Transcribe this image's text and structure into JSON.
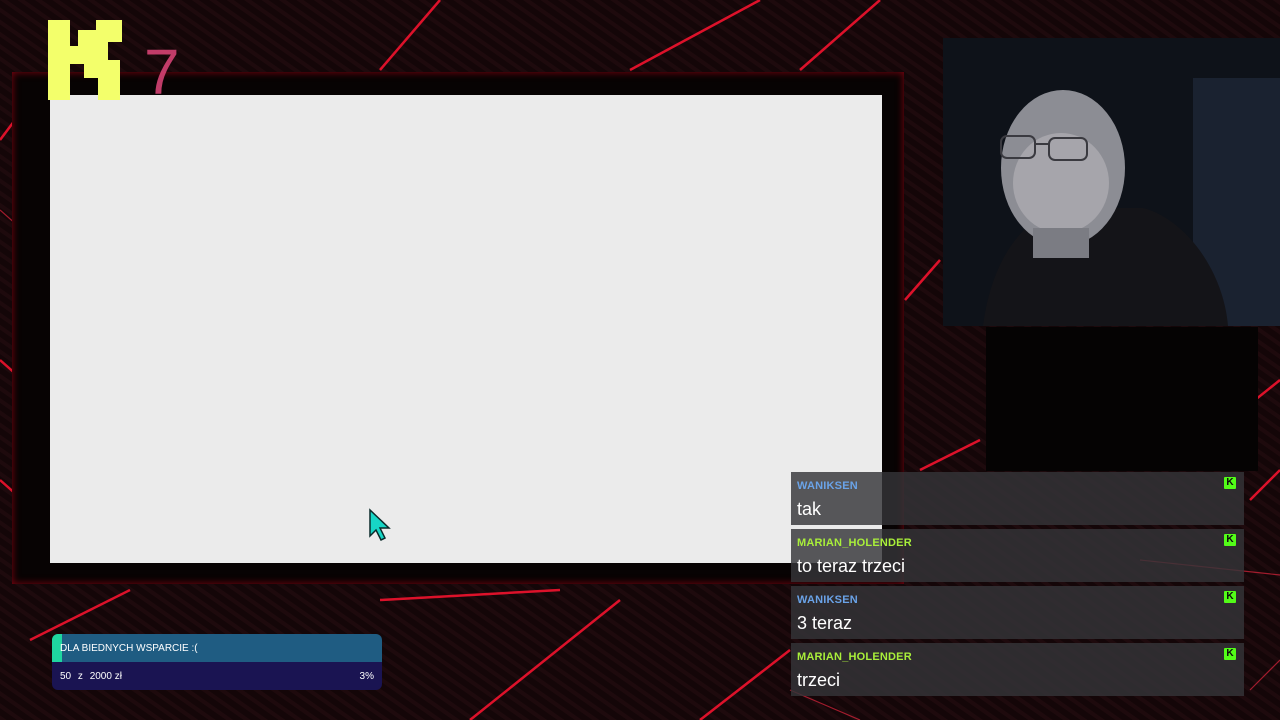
{
  "colors": {
    "accent_red": "#e8112d",
    "logo_yellow": "#f3ff6b",
    "logo_pink": "#e0467a",
    "kick_green": "#53fc18",
    "screen_bg": "#ebebeb",
    "cursor_teal": "#17d6c6",
    "donation_teal": "#1fd6a0",
    "donation_blue": "#1f5c82",
    "donation_navy": "#1a1452"
  },
  "logo": {
    "letter": "K",
    "digit": "7"
  },
  "chat": {
    "messages": [
      {
        "user": "WANIKSEN",
        "text": "tak",
        "user_color": "#6aa3e8"
      },
      {
        "user": "MARIAN_HOLENDER",
        "text": "to teraz trzeci",
        "user_color": "#a9ef3a"
      },
      {
        "user": "WANIKSEN",
        "text": "3 teraz",
        "user_color": "#6aa3e8"
      },
      {
        "user": "MARIAN_HOLENDER",
        "text": "trzeci",
        "user_color": "#a9ef3a"
      }
    ],
    "badge_icon": "kick-icon",
    "badge_letter": "K"
  },
  "donation": {
    "title": "DLA BIEDNYCH WSPARCIE :(",
    "current": "50",
    "separator": "z",
    "goal": "2000 zł",
    "percent": "3%",
    "progress_fraction": 0.03
  },
  "icons": {
    "cursor": "mouse-pointer-icon",
    "logo": "k7-logo-icon"
  }
}
